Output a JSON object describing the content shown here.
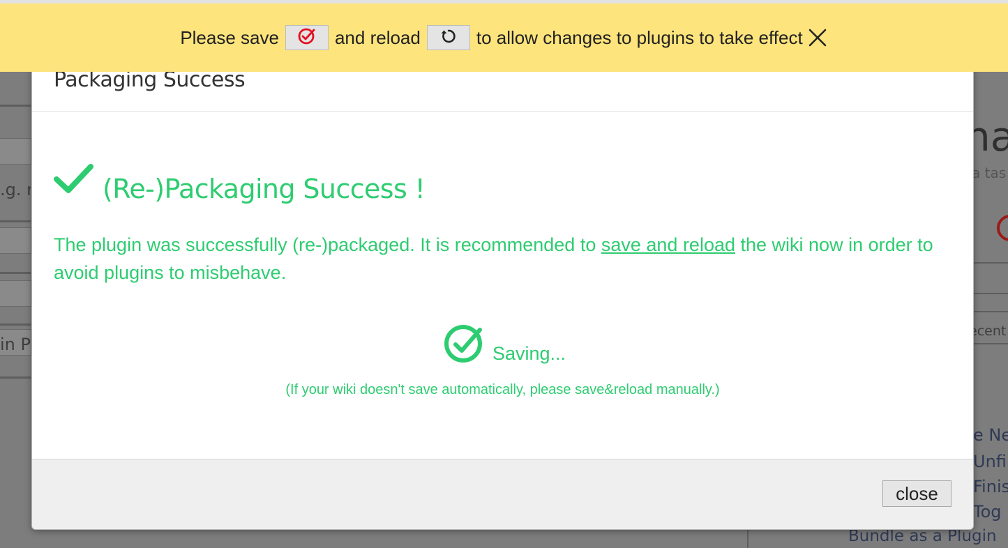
{
  "banner": {
    "text_before_save": "Please save",
    "text_between": "and reload",
    "text_after_reload": "to allow changes to plugins to take effect",
    "save_icon": "save-check-circle-icon",
    "reload_icon": "reload-arrow-icon",
    "close_icon": "close-x-icon",
    "background_color": "#fde47c"
  },
  "modal": {
    "title": "Packaging Success",
    "heading": "(Re-)Packaging Success !",
    "message_before_link": "The plugin was successfully (re-)packaged. It is recommended to ",
    "message_link": "save and reload",
    "message_after_link": " the wiki now in order to avoid plugins to misbehave.",
    "saving_label": "Saving...",
    "hint": "(If your wiki doesn't save automatically, please save&reload manually.)",
    "close_label": "close",
    "accent_color": "#2ecc71"
  },
  "background": {
    "left_text_1": ".g. n",
    "left_text_2": "in P",
    "right_heading": "nag",
    "right_subtitle": "a tas",
    "right_tab": "ecent",
    "right_list": [
      "e Ne",
      "Unfi",
      "Finis",
      "Tog"
    ],
    "bottom_item": "Bundle as a Plugin"
  }
}
